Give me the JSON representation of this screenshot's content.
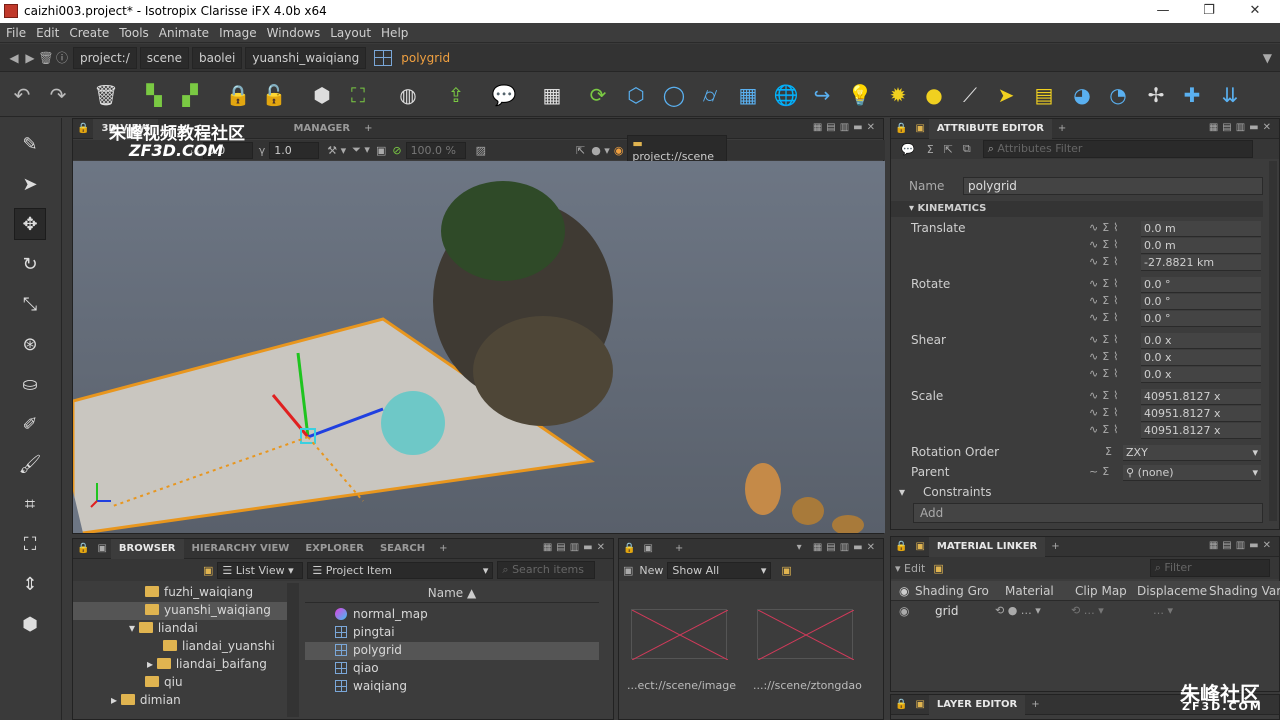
{
  "window": {
    "title": "caizhi003.project* - Isotropix Clarisse iFX 4.0b x64",
    "minimize": "—",
    "restore": "❐",
    "close": "✕"
  },
  "menu": [
    "File",
    "Edit",
    "Create",
    "Tools",
    "Animate",
    "Image",
    "Windows",
    "Layout",
    "Help"
  ],
  "path": {
    "crumbs": [
      "project:/",
      "scene",
      "baolei",
      "yuanshi_waiqiang"
    ],
    "current": "polygrid"
  },
  "watermark": {
    "text_cn": "朱峰视频教程社区",
    "text_en": "ZF3D.COM",
    "corner_cn": "朱峰社区",
    "corner_en": "ZF3D.COM"
  },
  "viewport": {
    "tabs": [
      "3D VIEW",
      "MANAGER"
    ],
    "fields": {
      "a": "0.0",
      "b": "1.0",
      "c": "100.0 %",
      "scene": "project://scene"
    }
  },
  "attr": {
    "tab": "ATTRIBUTE EDITOR",
    "filter_placeholder": "Attributes Filter",
    "name_label": "Name",
    "name_value": "polygrid",
    "section_kinematics": "KINEMATICS",
    "translate_label": "Translate",
    "translate": [
      "0.0 m",
      "0.0 m",
      "-27.8821 km"
    ],
    "rotate_label": "Rotate",
    "rotate": [
      "0.0 °",
      "0.0 °",
      "0.0 °"
    ],
    "shear_label": "Shear",
    "shear": [
      "0.0 x",
      "0.0 x",
      "0.0 x"
    ],
    "scale_label": "Scale",
    "scale": [
      "40951.8127 x",
      "40951.8127 x",
      "40951.8127 x"
    ],
    "rotorder_label": "Rotation Order",
    "rotorder_value": "ZXY",
    "parent_label": "Parent",
    "parent_value": "(none)",
    "constraints_label": "Constraints",
    "add_label": "Add"
  },
  "browser": {
    "tabs": [
      "BROWSER",
      "HIERARCHY VIEW",
      "EXPLORER",
      "SEARCH"
    ],
    "listview": "List View",
    "projectitem": "Project Item",
    "search_placeholder": "Search items",
    "tree": [
      "fuzhi_waiqiang",
      "yuanshi_waiqiang",
      "liandai",
      "liandai_yuanshi",
      "liandai_baifang",
      "qiu",
      "dimian"
    ],
    "col_name": "Name ▲",
    "items": [
      "normal_map",
      "pingtai",
      "polygrid",
      "qiao",
      "waiqiang"
    ]
  },
  "imgpanel": {
    "new_label": "New",
    "showall": "Show All",
    "thumbs": [
      "...ect://scene/image",
      "...://scene/ztongdao"
    ]
  },
  "matlinker": {
    "tab": "MATERIAL LINKER",
    "edit": "Edit",
    "filter_placeholder": "Filter",
    "columns": [
      "Shading Group",
      "Material",
      "Clip Map",
      "Displacement",
      "Shading Variable"
    ],
    "row": "grid"
  },
  "layered": {
    "tab": "LAYER EDITOR"
  },
  "colors": {
    "accent": "#f0a040",
    "selected_row": "#555555",
    "blue_icon": "#5ab0f0",
    "yellow_icon": "#f0d020",
    "green_icon": "#7ac943"
  }
}
